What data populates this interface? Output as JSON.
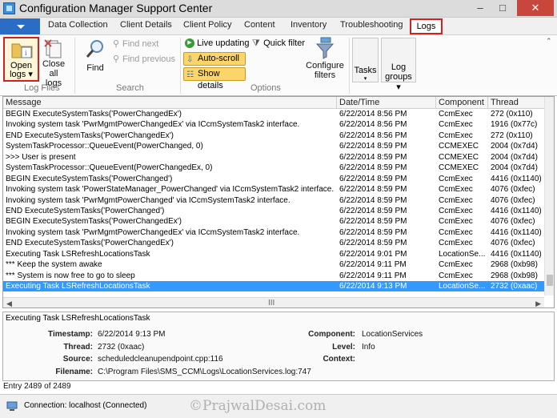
{
  "window": {
    "title": "Configuration Manager Support Center",
    "minimize": "–",
    "maximize": "□",
    "close": "✕"
  },
  "ribbon_tabs": [
    "Data Collection",
    "Client Details",
    "Client Policy",
    "Content",
    "Inventory",
    "Troubleshooting",
    "Logs"
  ],
  "ribbon": {
    "log_files": {
      "label": "Log Files",
      "open_logs_1": "Open",
      "open_logs_2": "logs ▾",
      "close_all_1": "Close all",
      "close_all_2": "logs"
    },
    "search": {
      "label": "Search",
      "find": "Find",
      "find_next": "Find next",
      "find_previous": "Find previous"
    },
    "options": {
      "label": "Options",
      "live_updating": "Live updating",
      "quick_filter": "Quick filter",
      "auto_scroll": "Auto-scroll",
      "show_details": "Show details",
      "configure_filters_1": "Configure",
      "configure_filters_2": "filters"
    },
    "tasks": "Tasks",
    "log_groups_1": "Log",
    "log_groups_2": "groups ▾"
  },
  "log_table": {
    "columns": [
      "Message",
      "Date/Time",
      "Component",
      "Thread"
    ],
    "rows": [
      {
        "message": "BEGIN ExecuteSystemTasks('PowerChangedEx')",
        "datetime": "6/22/2014 8:56 PM",
        "component": "CcmExec",
        "thread": "272 (0x110)"
      },
      {
        "message": "Invoking system task 'PwrMgmtPowerChangedEx' via ICcmSystemTask2 interface.",
        "datetime": "6/22/2014 8:56 PM",
        "component": "CcmExec",
        "thread": "1916 (0x77c)"
      },
      {
        "message": "END ExecuteSystemTasks('PowerChangedEx')",
        "datetime": "6/22/2014 8:56 PM",
        "component": "CcmExec",
        "thread": "272 (0x110)"
      },
      {
        "message": "SystemTaskProcessor::QueueEvent(PowerChanged, 0)",
        "datetime": "6/22/2014 8:59 PM",
        "component": "CCMEXEC",
        "thread": "2004 (0x7d4)"
      },
      {
        "message": ">>> User is present",
        "datetime": "6/22/2014 8:59 PM",
        "component": "CCMEXEC",
        "thread": "2004 (0x7d4)"
      },
      {
        "message": "SystemTaskProcessor::QueueEvent(PowerChangedEx, 0)",
        "datetime": "6/22/2014 8:59 PM",
        "component": "CCMEXEC",
        "thread": "2004 (0x7d4)"
      },
      {
        "message": "BEGIN ExecuteSystemTasks('PowerChanged')",
        "datetime": "6/22/2014 8:59 PM",
        "component": "CcmExec",
        "thread": "4416 (0x1140)"
      },
      {
        "message": "Invoking system task 'PowerStateManager_PowerChanged' via ICcmSystemTask2 interface.",
        "datetime": "6/22/2014 8:59 PM",
        "component": "CcmExec",
        "thread": "4076 (0xfec)"
      },
      {
        "message": "Invoking system task 'PwrMgmtPowerChanged' via ICcmSystemTask2 interface.",
        "datetime": "6/22/2014 8:59 PM",
        "component": "CcmExec",
        "thread": "4076 (0xfec)"
      },
      {
        "message": "END ExecuteSystemTasks('PowerChanged')",
        "datetime": "6/22/2014 8:59 PM",
        "component": "CcmExec",
        "thread": "4416 (0x1140)"
      },
      {
        "message": "BEGIN ExecuteSystemTasks('PowerChangedEx')",
        "datetime": "6/22/2014 8:59 PM",
        "component": "CcmExec",
        "thread": "4076 (0xfec)"
      },
      {
        "message": "Invoking system task 'PwrMgmtPowerChangedEx' via ICcmSystemTask2 interface.",
        "datetime": "6/22/2014 8:59 PM",
        "component": "CcmExec",
        "thread": "4416 (0x1140)"
      },
      {
        "message": "END ExecuteSystemTasks('PowerChangedEx')",
        "datetime": "6/22/2014 8:59 PM",
        "component": "CcmExec",
        "thread": "4076 (0xfec)"
      },
      {
        "message": "Executing Task LSRefreshLocationsTask",
        "datetime": "6/22/2014 9:01 PM",
        "component": "LocationSe...",
        "thread": "4416 (0x1140)"
      },
      {
        "message": "*** Keep the system awake",
        "datetime": "6/22/2014 9:11 PM",
        "component": "CcmExec",
        "thread": "2968 (0xb98)"
      },
      {
        "message": "*** System is now free to go to sleep",
        "datetime": "6/22/2014 9:11 PM",
        "component": "CcmExec",
        "thread": "2968 (0xb98)"
      },
      {
        "message": "Executing Task LSRefreshLocationsTask",
        "datetime": "6/22/2014 9:13 PM",
        "component": "LocationSe...",
        "thread": "2732 (0xaac)"
      }
    ],
    "scroll_grip": "III"
  },
  "details": {
    "message": "Executing Task LSRefreshLocationsTask",
    "timestamp_label": "Timestamp:",
    "timestamp": "6/22/2014 9:13 PM",
    "thread_label": "Thread:",
    "thread": "2732 (0xaac)",
    "source_label": "Source:",
    "source": "scheduledcleanupendpoint.cpp:116",
    "filename_label": "Filename:",
    "filename": "C:\\Program Files\\SMS_CCM\\Logs\\LocationServices.log:747",
    "component_label": "Component:",
    "component": "LocationServices",
    "level_label": "Level:",
    "level": "Info",
    "context_label": "Context:"
  },
  "entry_count": "Entry 2489 of 2489",
  "status": {
    "connection": "Connection: localhost (Connected)",
    "watermark": "©PrajwalDesai.com"
  }
}
